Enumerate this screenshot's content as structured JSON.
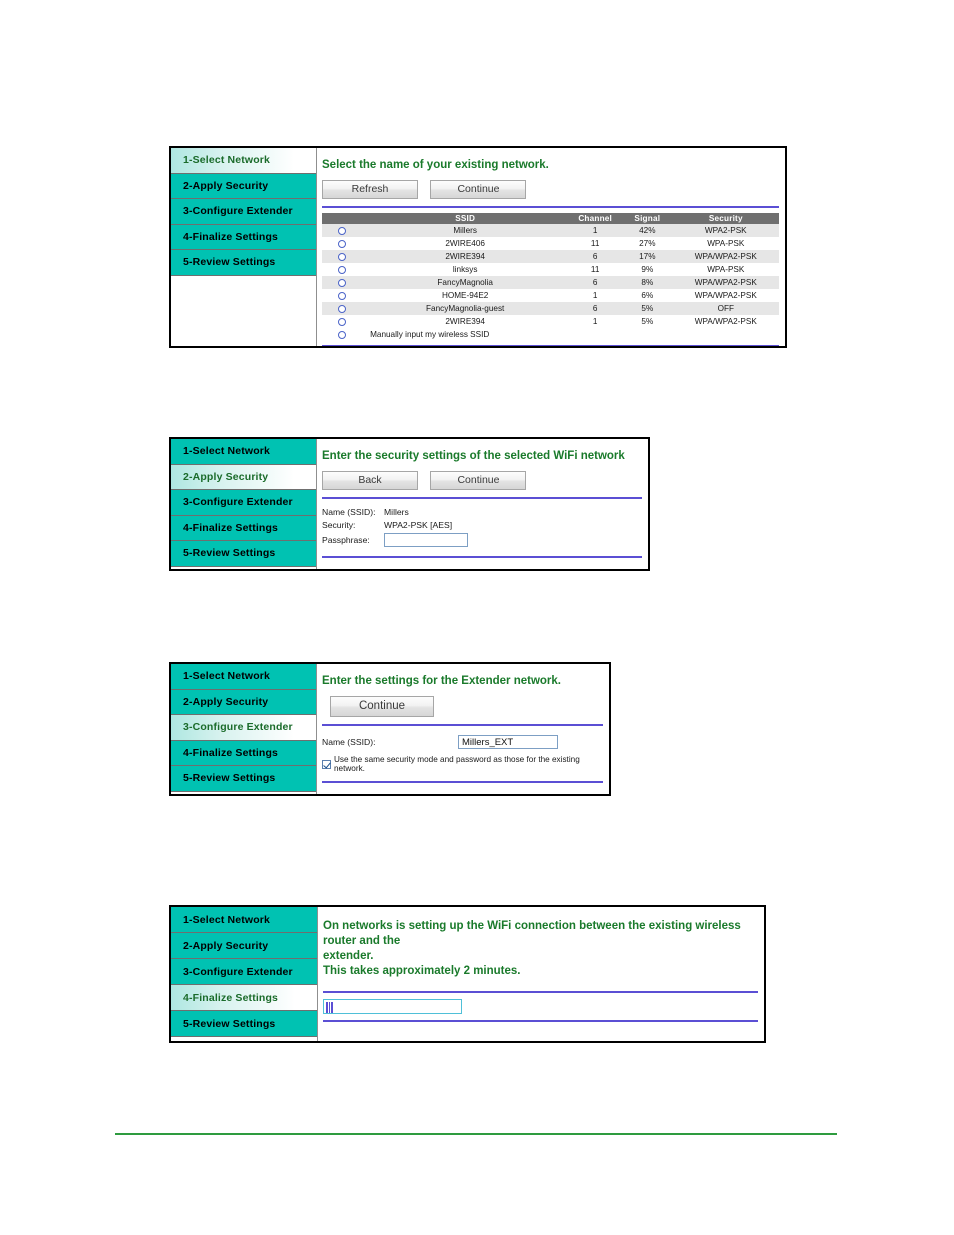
{
  "wizard": {
    "nav_items": [
      "1-Select Network",
      "2-Apply Security",
      "3-Configure Extender",
      "4-Finalize Settings",
      "5-Review Settings"
    ]
  },
  "panel1": {
    "heading": "Select the name of your existing network.",
    "buttons": {
      "refresh": "Refresh",
      "continue": "Continue"
    },
    "table": {
      "columns": [
        "",
        "SSID",
        "Channel",
        "Signal",
        "Security"
      ],
      "rows": [
        {
          "ssid": "Millers",
          "channel": "1",
          "signal": "42%",
          "security": "WPA2-PSK"
        },
        {
          "ssid": "2WIRE406",
          "channel": "11",
          "signal": "27%",
          "security": "WPA-PSK"
        },
        {
          "ssid": "2WIRE394",
          "channel": "6",
          "signal": "17%",
          "security": "WPA/WPA2-PSK"
        },
        {
          "ssid": "linksys",
          "channel": "11",
          "signal": "9%",
          "security": "WPA-PSK"
        },
        {
          "ssid": "FancyMagnolia",
          "channel": "6",
          "signal": "8%",
          "security": "WPA/WPA2-PSK"
        },
        {
          "ssid": "HOME-94E2",
          "channel": "1",
          "signal": "6%",
          "security": "WPA/WPA2-PSK"
        },
        {
          "ssid": "FancyMagnolia-guest",
          "channel": "6",
          "signal": "5%",
          "security": "OFF"
        },
        {
          "ssid": "2WIRE394",
          "channel": "1",
          "signal": "5%",
          "security": "WPA/WPA2-PSK"
        }
      ],
      "manual_option": "Manually input my wireless SSID"
    },
    "active_nav_index": 0
  },
  "panel2": {
    "heading": "Enter the security settings of the selected WiFi network",
    "buttons": {
      "back": "Back",
      "continue": "Continue"
    },
    "fields": {
      "name_label": "Name (SSID):",
      "name_value": "Millers",
      "security_label": "Security:",
      "security_value": "WPA2-PSK [AES]",
      "passphrase_label": "Passphrase:",
      "passphrase_value": ""
    },
    "active_nav_index": 1
  },
  "panel3": {
    "heading": "Enter the settings for the Extender network.",
    "buttons": {
      "continue": "Continue"
    },
    "fields": {
      "name_label": "Name (SSID):",
      "name_value": "Millers_EXT",
      "checkbox_label": "Use the same security mode and password as those for the existing network.",
      "checkbox_checked": true
    },
    "active_nav_index": 2
  },
  "panel4": {
    "heading_line1": "On networks is setting up the WiFi connection between the existing wireless router and the",
    "heading_line2": "extender.",
    "heading_line3": "This takes approximately 2 minutes.",
    "progress_ticks": 3,
    "active_nav_index": 3
  },
  "colors": {
    "nav_teal": "#00c2b2",
    "heading_green": "#1a7a2b",
    "rule_purple": "#5b4fd4",
    "table_header_gray": "#6f6f6f",
    "footer_green": "#2e9b3f"
  }
}
